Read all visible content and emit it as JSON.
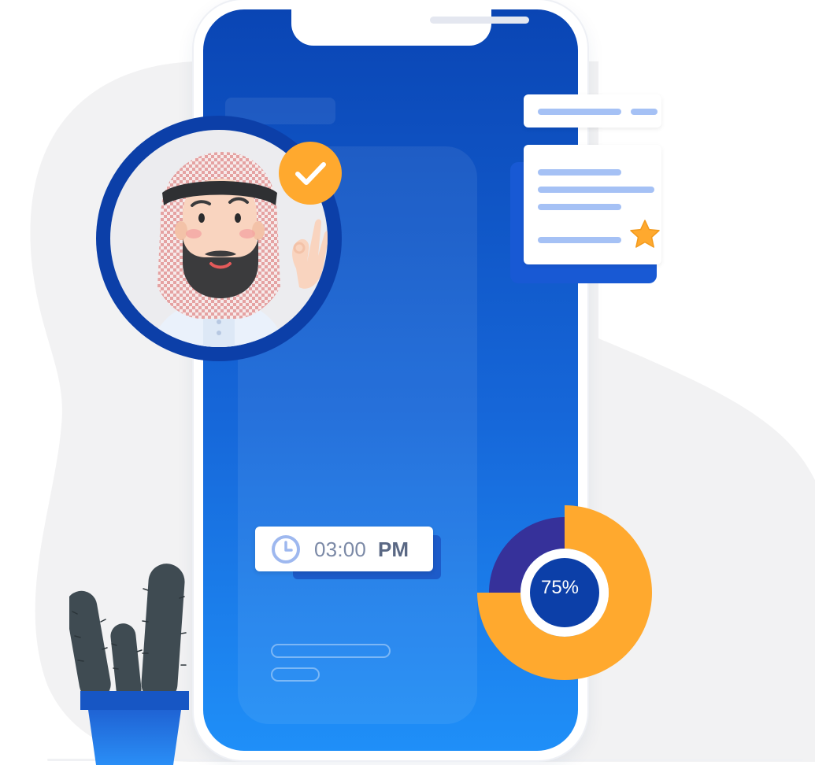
{
  "colors": {
    "background_blob": "#f2f2f3",
    "phone_top": "#0a45b4",
    "phone_bottom": "#1f8ff8",
    "accent_orange": "#ffa92e",
    "accent_navy": "#0c3fa8",
    "donut_remaining": "#36319a",
    "line_blue": "#a5c1f5"
  },
  "time_chip": {
    "icon": "clock-icon",
    "time": "03:00",
    "period": "PM"
  },
  "progress": {
    "label": "75%",
    "value": 0.75
  },
  "avatar": {
    "icon": "verified-check-icon",
    "gesture": "ok-hand"
  },
  "document_card": {
    "icon": "star-icon"
  },
  "decor": {
    "plant": "cactus-in-blue-pot"
  }
}
